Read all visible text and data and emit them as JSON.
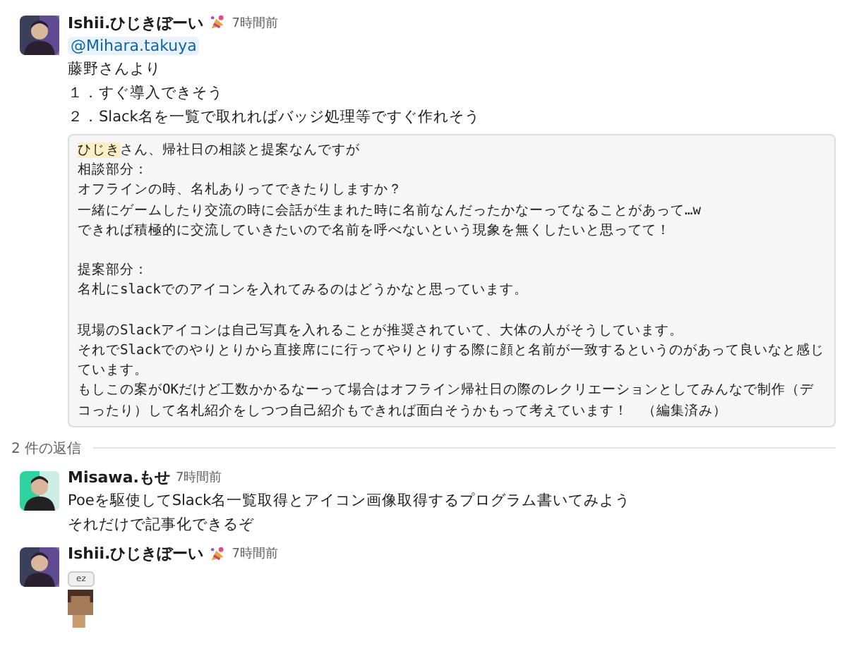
{
  "messages": [
    {
      "author": "Ishii.ひじきぼーい",
      "has_status_emoji": true,
      "time": "7時間前",
      "mention": "@Mihara.takuya",
      "lines": [
        "藤野さんより",
        "１．すぐ導入できそう",
        "２．Slack名を一覧で取れればバッジ処理等ですぐ作れそう"
      ],
      "code_block": {
        "paragraphs": [
          [
            {
              "mention": "ひじき",
              "text": "さん、帰社日の相談と提案なんですが"
            },
            {
              "text": "相談部分："
            },
            {
              "text": "オフラインの時、名札ありってできたりしますか？"
            },
            {
              "text": "一緒にゲームしたり交流の時に会話が生まれた時に名前なんだったかなーってなることがあって…w"
            },
            {
              "text": "できれば積極的に交流していきたいので名前を呼べないという現象を無くしたいと思ってて！"
            }
          ],
          [
            {
              "text": "提案部分："
            },
            {
              "text": "名札にslackでのアイコンを入れてみるのはどうかなと思っています。"
            }
          ],
          [
            {
              "text": "現場のSlackアイコンは自己写真を入れることが推奨されていて、大体の人がそうしています。"
            },
            {
              "text": "それでSlackでのやりとりから直接席にに行ってやりとりする際に顔と名前が一致するというのがあって良いなと感じています。"
            },
            {
              "text": "もしこの案がOKだけど工数かかるなーって場合はオフライン帰社日の際のレクリエーションとしてみんなで制作（デコったり）して名札紹介をしつつ自己紹介もできれば面白そうかもって考えています！　（編集済み）"
            }
          ]
        ]
      }
    }
  ],
  "thread": {
    "reply_count": "2 件の返信",
    "replies": [
      {
        "author": "Misawa.もせ",
        "has_status_emoji": false,
        "time": "7時間前",
        "lines": [
          "Poeを駆使してSlack名一覧取得とアイコン画像取得するプログラム書いてみよう",
          "それだけで記事化できるぞ"
        ]
      },
      {
        "author": "Ishii.ひじきぼーい",
        "has_status_emoji": true,
        "time": "7時間前",
        "sticker": {
          "bubble": "ez"
        }
      }
    ]
  }
}
